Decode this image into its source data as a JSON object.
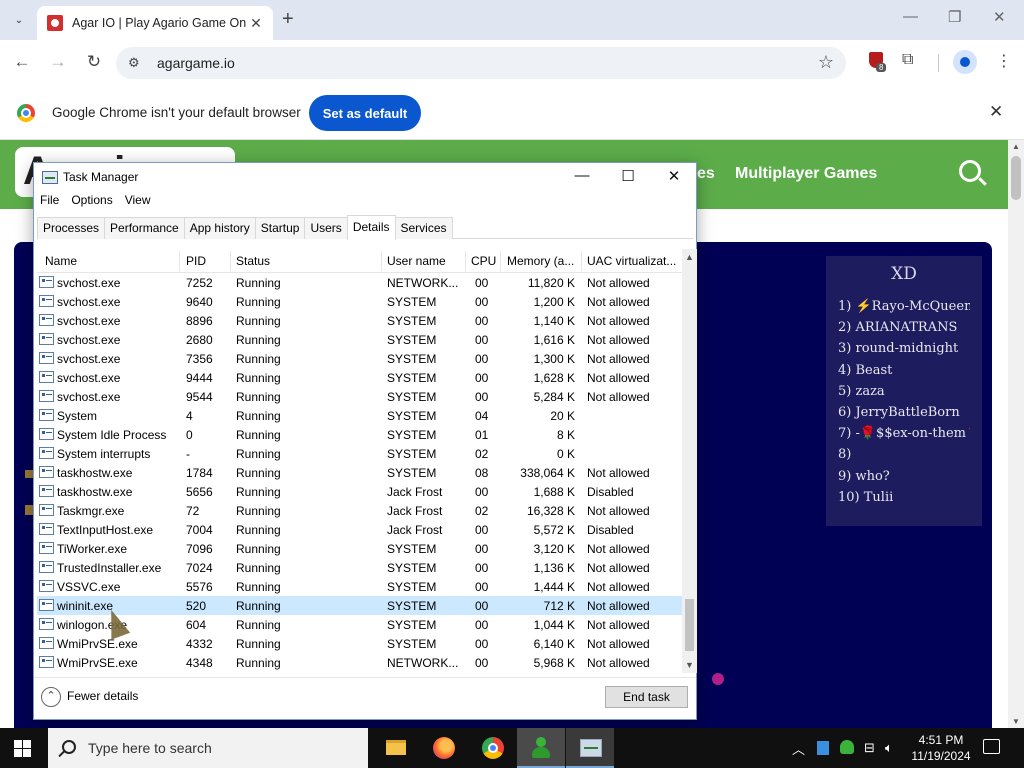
{
  "browser": {
    "tab": {
      "title": "Agar IO | Play Agario Game On"
    },
    "url": "agargame.io",
    "extension_badge": "8",
    "infobar": {
      "message": "Google Chrome isn't your default browser",
      "button": "Set as default"
    }
  },
  "site": {
    "logo_text": "Agario",
    "nav_partial": "es",
    "nav_multiplayer": "Multiplayer Games",
    "leaderboard": {
      "title": "XD",
      "entries": [
        "1) ⚡Rayo-McQueen⭐",
        "2) ARIANATRANS",
        "3) round-midnight",
        "4) Beast",
        "5) zaza",
        "6) JerryBattleBorn",
        "7) -🌹$$ex-on-them🌹-",
        "8)",
        "9) who?",
        "10) Tulii"
      ]
    }
  },
  "task_manager": {
    "title": "Task Manager",
    "menu": [
      "File",
      "Options",
      "View"
    ],
    "tabs": [
      "Processes",
      "Performance",
      "App history",
      "Startup",
      "Users",
      "Details",
      "Services"
    ],
    "active_tab": "Details",
    "columns": {
      "name": "Name",
      "pid": "PID",
      "status": "Status",
      "user": "User name",
      "cpu": "CPU",
      "memory": "Memory (a...",
      "uac": "UAC virtualizat..."
    },
    "rows": [
      {
        "name": "svchost.exe",
        "pid": "7252",
        "status": "Running",
        "user": "NETWORK...",
        "cpu": "00",
        "memory": "11,820 K",
        "uac": "Not allowed"
      },
      {
        "name": "svchost.exe",
        "pid": "9640",
        "status": "Running",
        "user": "SYSTEM",
        "cpu": "00",
        "memory": "1,200 K",
        "uac": "Not allowed"
      },
      {
        "name": "svchost.exe",
        "pid": "8896",
        "status": "Running",
        "user": "SYSTEM",
        "cpu": "00",
        "memory": "1,140 K",
        "uac": "Not allowed"
      },
      {
        "name": "svchost.exe",
        "pid": "2680",
        "status": "Running",
        "user": "SYSTEM",
        "cpu": "00",
        "memory": "1,616 K",
        "uac": "Not allowed"
      },
      {
        "name": "svchost.exe",
        "pid": "7356",
        "status": "Running",
        "user": "SYSTEM",
        "cpu": "00",
        "memory": "1,300 K",
        "uac": "Not allowed"
      },
      {
        "name": "svchost.exe",
        "pid": "9444",
        "status": "Running",
        "user": "SYSTEM",
        "cpu": "00",
        "memory": "1,628 K",
        "uac": "Not allowed"
      },
      {
        "name": "svchost.exe",
        "pid": "9544",
        "status": "Running",
        "user": "SYSTEM",
        "cpu": "00",
        "memory": "5,284 K",
        "uac": "Not allowed"
      },
      {
        "name": "System",
        "pid": "4",
        "status": "Running",
        "user": "SYSTEM",
        "cpu": "04",
        "memory": "20 K",
        "uac": ""
      },
      {
        "name": "System Idle Process",
        "pid": "0",
        "status": "Running",
        "user": "SYSTEM",
        "cpu": "01",
        "memory": "8 K",
        "uac": ""
      },
      {
        "name": "System interrupts",
        "pid": "-",
        "status": "Running",
        "user": "SYSTEM",
        "cpu": "02",
        "memory": "0 K",
        "uac": ""
      },
      {
        "name": "taskhostw.exe",
        "pid": "1784",
        "status": "Running",
        "user": "SYSTEM",
        "cpu": "08",
        "memory": "338,064 K",
        "uac": "Not allowed"
      },
      {
        "name": "taskhostw.exe",
        "pid": "5656",
        "status": "Running",
        "user": "Jack Frost",
        "cpu": "00",
        "memory": "1,688 K",
        "uac": "Disabled"
      },
      {
        "name": "Taskmgr.exe",
        "pid": "72",
        "status": "Running",
        "user": "Jack Frost",
        "cpu": "02",
        "memory": "16,328 K",
        "uac": "Not allowed"
      },
      {
        "name": "TextInputHost.exe",
        "pid": "7004",
        "status": "Running",
        "user": "Jack Frost",
        "cpu": "00",
        "memory": "5,572 K",
        "uac": "Disabled"
      },
      {
        "name": "TiWorker.exe",
        "pid": "7096",
        "status": "Running",
        "user": "SYSTEM",
        "cpu": "00",
        "memory": "3,120 K",
        "uac": "Not allowed"
      },
      {
        "name": "TrustedInstaller.exe",
        "pid": "7024",
        "status": "Running",
        "user": "SYSTEM",
        "cpu": "00",
        "memory": "1,136 K",
        "uac": "Not allowed"
      },
      {
        "name": "VSSVC.exe",
        "pid": "5576",
        "status": "Running",
        "user": "SYSTEM",
        "cpu": "00",
        "memory": "1,444 K",
        "uac": "Not allowed"
      },
      {
        "name": "wininit.exe",
        "pid": "520",
        "status": "Running",
        "user": "SYSTEM",
        "cpu": "00",
        "memory": "712 K",
        "uac": "Not allowed",
        "selected": true
      },
      {
        "name": "winlogon.exe",
        "pid": "604",
        "status": "Running",
        "user": "SYSTEM",
        "cpu": "00",
        "memory": "1,044 K",
        "uac": "Not allowed"
      },
      {
        "name": "WmiPrvSE.exe",
        "pid": "4332",
        "status": "Running",
        "user": "SYSTEM",
        "cpu": "00",
        "memory": "6,140 K",
        "uac": "Not allowed"
      },
      {
        "name": "WmiPrvSE.exe",
        "pid": "4348",
        "status": "Running",
        "user": "NETWORK...",
        "cpu": "00",
        "memory": "5,968 K",
        "uac": "Not allowed"
      }
    ],
    "fewer_details": "Fewer details",
    "end_task": "End task"
  },
  "taskbar": {
    "search_placeholder": "Type here to search",
    "time": "4:51 PM",
    "date": "11/19/2024"
  }
}
